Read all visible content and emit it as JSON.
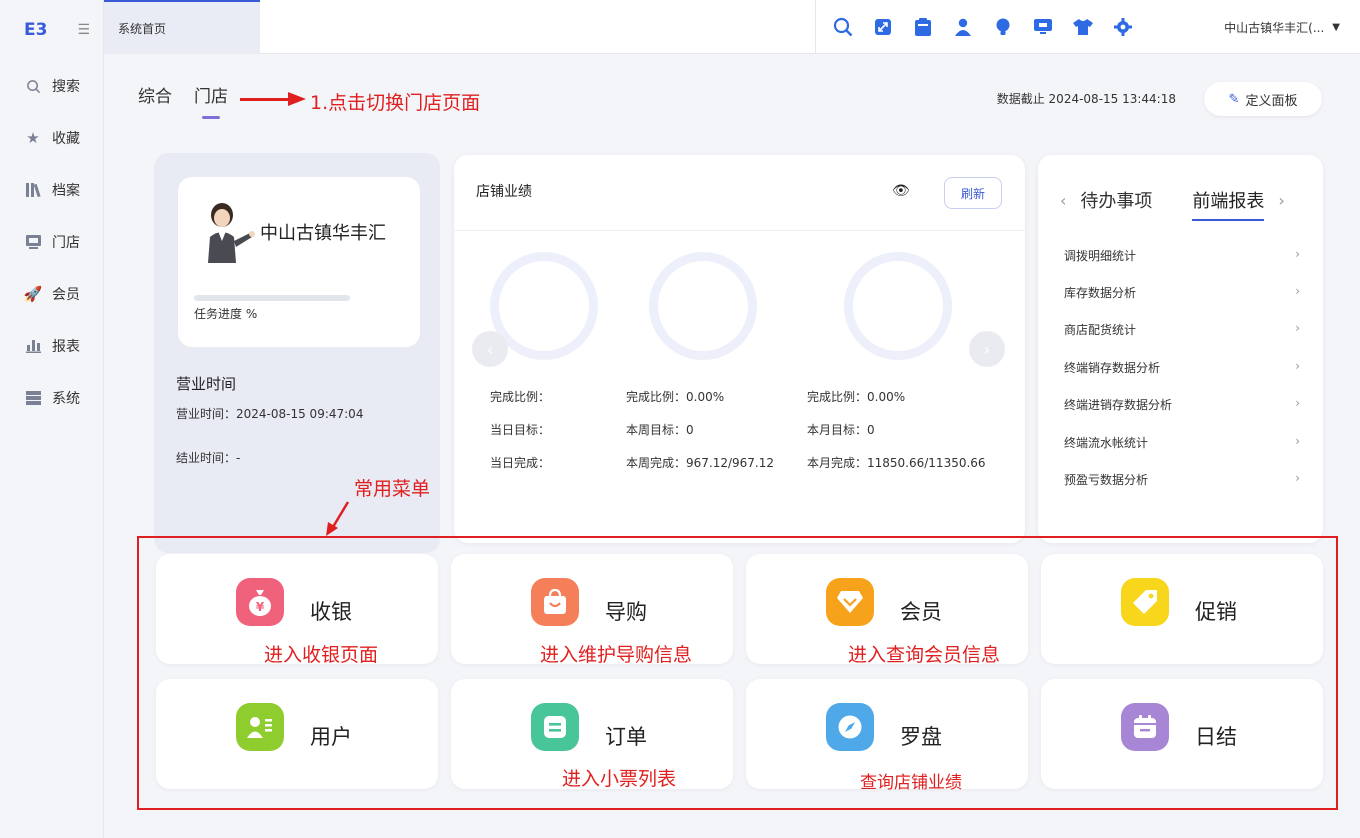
{
  "sidebar": {
    "logo": "E3",
    "items": [
      {
        "label": "搜索",
        "icon": "search-icon"
      },
      {
        "label": "收藏",
        "icon": "star-icon"
      },
      {
        "label": "档案",
        "icon": "books-icon"
      },
      {
        "label": "门店",
        "icon": "store-icon"
      },
      {
        "label": "会员",
        "icon": "rocket-icon"
      },
      {
        "label": "报表",
        "icon": "bar-chart-icon"
      },
      {
        "label": "系统",
        "icon": "server-icon"
      }
    ]
  },
  "topbar": {
    "active_tab": "系统首页",
    "store_select": "中山古镇华丰汇(...",
    "tools": [
      "search-icon",
      "expand-icon",
      "clipboard-icon",
      "user-icon",
      "bulb-icon",
      "screen-icon",
      "shirt-icon",
      "gear-icon"
    ]
  },
  "main": {
    "tabs": [
      "综合",
      "门店"
    ],
    "active_tab": "门店",
    "switch_annotation": "1.点击切换门店页面",
    "data_cutoff": "数据截止 2024-08-15 13:44:18",
    "define_panel_button": "定义面板"
  },
  "store": {
    "name": "中山古镇华丰汇",
    "progress_label": "任务进度 %",
    "progress_fraction": 0,
    "business_hours_title": "营业时间",
    "open_time": "营业时间：2024-08-15 09:47:04",
    "close_time": "结业时间：-"
  },
  "performance": {
    "title": "店铺业绩",
    "refresh_button": "刷新",
    "columns": [
      {
        "ratio": "完成比例：",
        "target": "当日目标：",
        "done": "当日完成："
      },
      {
        "ratio": "完成比例：0.00%",
        "target": "本周目标：0",
        "done": "本周完成：967.12/967.12"
      },
      {
        "ratio": "完成比例：0.00%",
        "target": "本月目标：0",
        "done": "本月完成：11850.66/11350.66"
      }
    ]
  },
  "reports": {
    "tabs": [
      "待办事项",
      "前端报表"
    ],
    "active_tab": "前端报表",
    "items": [
      "调拨明细统计",
      "库存数据分析",
      "商店配货统计",
      "终端销存数据分析",
      "终端进销存数据分析",
      "终端流水帐统计",
      "预盈亏数据分析"
    ]
  },
  "common_menu": {
    "annotation": "常用菜单",
    "tiles": [
      {
        "label": "收银",
        "icon": "money-bag-icon",
        "color": "#f0627b",
        "annotation": "进入收银页面"
      },
      {
        "label": "导购",
        "icon": "shopping-bag-icon",
        "color": "#f57f59",
        "annotation": "进入维护导购信息"
      },
      {
        "label": "会员",
        "icon": "diamond-icon",
        "color": "#f7a21b",
        "annotation": "进入查询会员信息"
      },
      {
        "label": "促销",
        "icon": "tag-icon",
        "color": "#f7d61b",
        "annotation": ""
      },
      {
        "label": "用户",
        "icon": "id-card-icon",
        "color": "#8fcc2e",
        "annotation": ""
      },
      {
        "label": "订单",
        "icon": "receipt-icon",
        "color": "#49c59a",
        "annotation": "进入小票列表"
      },
      {
        "label": "罗盘",
        "icon": "compass-icon",
        "color": "#4fa8e8",
        "annotation": "查询店铺业绩"
      },
      {
        "label": "日结",
        "icon": "calendar-icon",
        "color": "#a786d6",
        "annotation": ""
      }
    ]
  }
}
